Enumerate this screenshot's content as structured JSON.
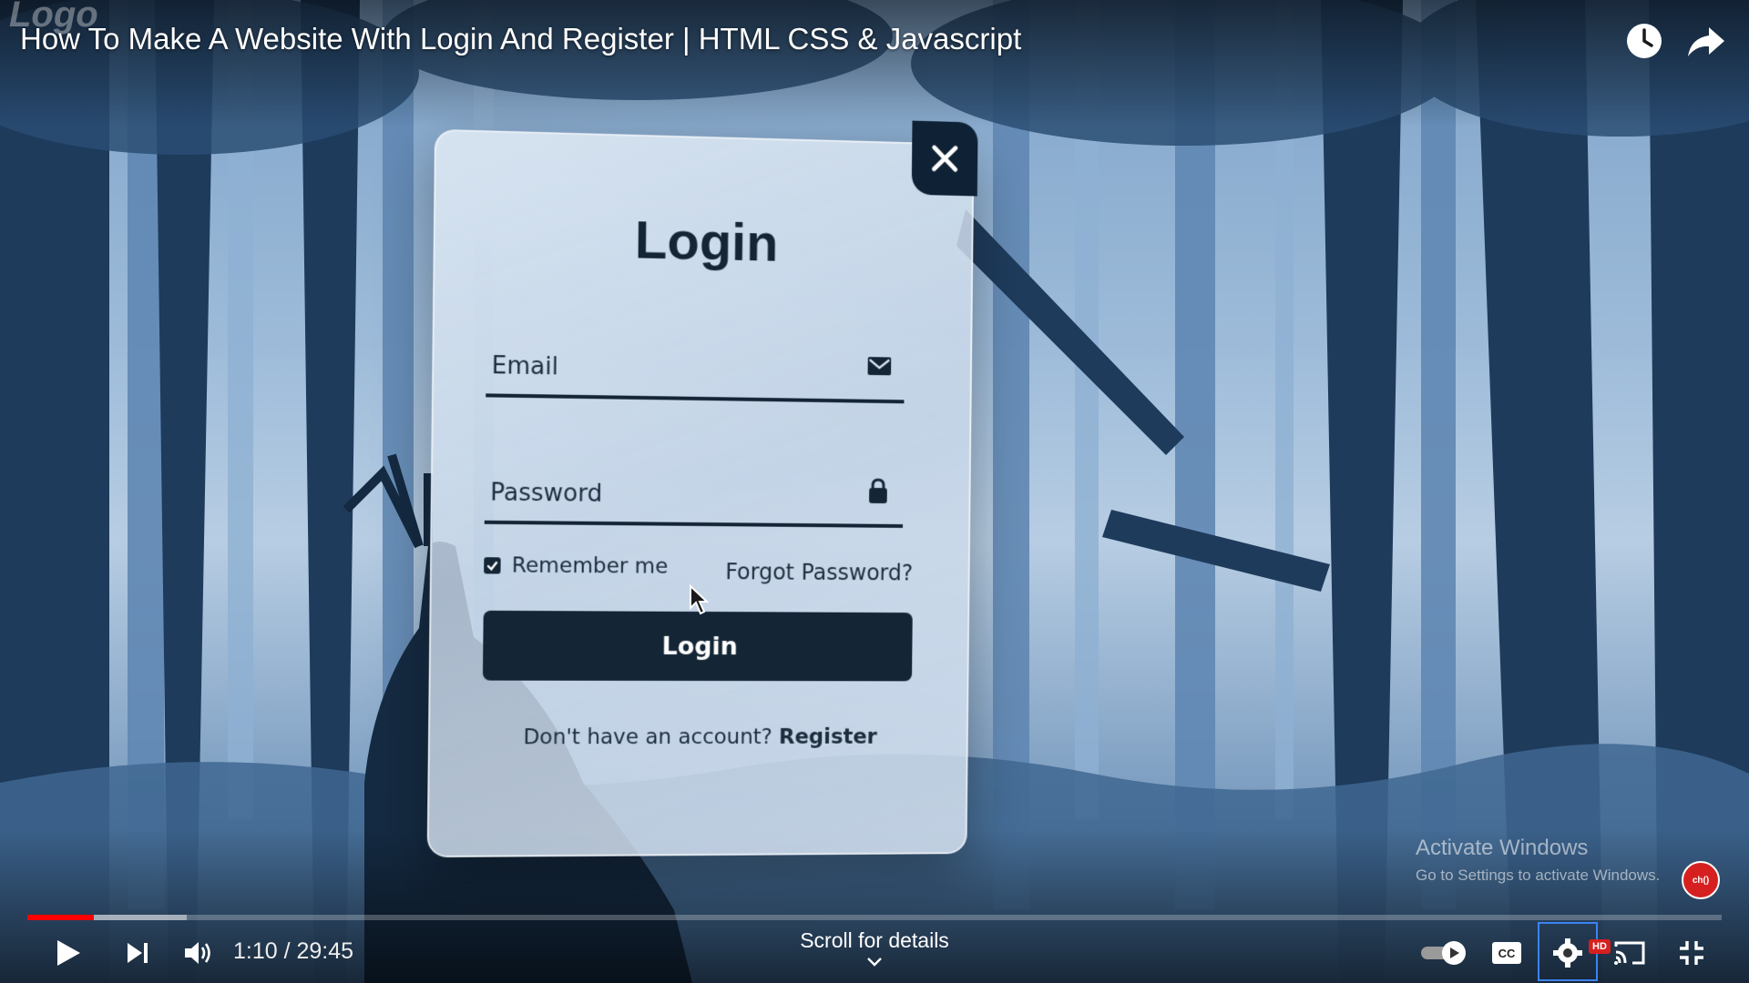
{
  "video": {
    "logo": "Logo",
    "title": "How To Make A Website With Login And Register | HTML CSS & Javascript",
    "watch_later_icon": "clock-icon",
    "share_icon": "share-icon"
  },
  "login_form": {
    "title": "Login",
    "email_placeholder": "Email",
    "email_icon": "envelope-icon",
    "password_placeholder": "Password",
    "password_icon": "lock-icon",
    "remember_label": "Remember me",
    "remember_checked": true,
    "forgot_label": "Forgot Password?",
    "submit_label": "Login",
    "register_prompt": "Don't have an account?",
    "register_link": "Register",
    "close_icon": "close-icon"
  },
  "watermark": {
    "line1": "Activate Windows",
    "line2": "Go to Settings to activate Windows.",
    "badge": "ch()"
  },
  "player": {
    "current_time": "1:10",
    "duration": "29:45",
    "time_display": "1:10 / 29:45",
    "progress_fraction": 0.0392,
    "buffered_fraction": 0.094,
    "scroll_hint": "Scroll for details",
    "quality_badge": "HD",
    "colors": {
      "progress": "#ff0000",
      "settings_highlight": "#3d82f0"
    }
  }
}
